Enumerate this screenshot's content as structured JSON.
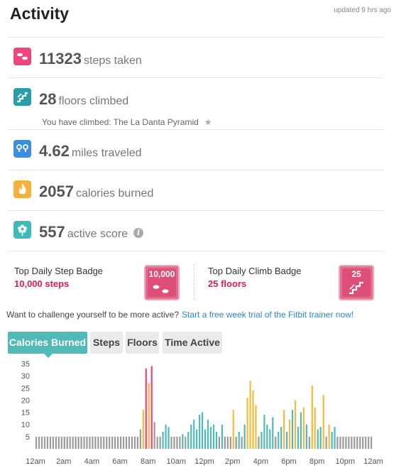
{
  "header": {
    "title": "Activity",
    "updated": "updated 9 hrs ago"
  },
  "stats": [
    {
      "value": "11323",
      "unit": "steps taken",
      "icon": "footsteps-icon",
      "color": "#f0457a"
    },
    {
      "value": "28",
      "unit": "floors climbed",
      "icon": "stairs-icon",
      "color": "#2a9da6",
      "sub": "You have climbed: The La Danta Pyramid"
    },
    {
      "value": "4.62",
      "unit": "miles traveled",
      "icon": "route-icon",
      "color": "#3b8ee0"
    },
    {
      "value": "2057",
      "unit": "calories burned",
      "icon": "flame-icon",
      "color": "#f7b03a"
    },
    {
      "value": "557",
      "unit": "active score",
      "icon": "flower-icon",
      "color": "#3fbbb5"
    }
  ],
  "badges": {
    "step": {
      "label": "Top Daily Step Badge",
      "value": "10,000 steps",
      "badge_text": "10,000"
    },
    "climb": {
      "label": "Top Daily Climb Badge",
      "value": "25 floors",
      "badge_text": "25"
    }
  },
  "promo": {
    "text": "Want to challenge yourself to be more active?",
    "link": "Start a free week trial of the Fitbit trainer now!"
  },
  "tabs": [
    {
      "label": "Calories Burned",
      "active": true
    },
    {
      "label": "Steps",
      "active": false
    },
    {
      "label": "Floors",
      "active": false
    },
    {
      "label": "Time Active",
      "active": false
    }
  ],
  "colors": {
    "sedentary": "#999999",
    "light": "#4fbab6",
    "moderate": "#f7b93a",
    "very": "#f0457a"
  },
  "chart_data": {
    "type": "bar",
    "ylim": [
      0,
      35
    ],
    "yticks": [
      "5",
      "10",
      "15",
      "20",
      "25",
      "30",
      "35"
    ],
    "xticks": [
      "12am",
      "2am",
      "4am",
      "6am",
      "8am",
      "10am",
      "12pm",
      "2pm",
      "4pm",
      "6pm",
      "8pm",
      "10pm",
      "12am"
    ],
    "baseline": 5,
    "bars": [
      {
        "i": 37,
        "v": 8,
        "level": "sedentary"
      },
      {
        "i": 38,
        "v": 16,
        "level": "moderate"
      },
      {
        "i": 39,
        "v": 33,
        "level": "very"
      },
      {
        "i": 40,
        "v": 27,
        "level": "moderate"
      },
      {
        "i": 41,
        "v": 34,
        "level": "very"
      },
      {
        "i": 42,
        "v": 11,
        "level": "sedentary"
      },
      {
        "i": 45,
        "v": 7,
        "level": "light"
      },
      {
        "i": 46,
        "v": 10,
        "level": "light"
      },
      {
        "i": 47,
        "v": 9,
        "level": "light"
      },
      {
        "i": 52,
        "v": 6,
        "level": "light"
      },
      {
        "i": 54,
        "v": 7,
        "level": "light"
      },
      {
        "i": 55,
        "v": 10,
        "level": "light"
      },
      {
        "i": 56,
        "v": 12,
        "level": "light"
      },
      {
        "i": 57,
        "v": 8,
        "level": "light"
      },
      {
        "i": 58,
        "v": 14,
        "level": "light"
      },
      {
        "i": 59,
        "v": 15,
        "level": "light"
      },
      {
        "i": 60,
        "v": 8,
        "level": "light"
      },
      {
        "i": 61,
        "v": 12,
        "level": "light"
      },
      {
        "i": 62,
        "v": 9,
        "level": "light"
      },
      {
        "i": 63,
        "v": 10,
        "level": "light"
      },
      {
        "i": 64,
        "v": 7,
        "level": "light"
      },
      {
        "i": 66,
        "v": 10,
        "level": "light"
      },
      {
        "i": 70,
        "v": 16,
        "level": "moderate"
      },
      {
        "i": 72,
        "v": 7,
        "level": "light"
      },
      {
        "i": 74,
        "v": 10,
        "level": "light"
      },
      {
        "i": 75,
        "v": 21,
        "level": "moderate"
      },
      {
        "i": 76,
        "v": 28,
        "level": "moderate"
      },
      {
        "i": 77,
        "v": 24,
        "level": "moderate"
      },
      {
        "i": 78,
        "v": 18,
        "level": "moderate"
      },
      {
        "i": 80,
        "v": 7,
        "level": "light"
      },
      {
        "i": 81,
        "v": 14,
        "level": "light"
      },
      {
        "i": 82,
        "v": 10,
        "level": "light"
      },
      {
        "i": 83,
        "v": 8,
        "level": "light"
      },
      {
        "i": 84,
        "v": 13,
        "level": "light"
      },
      {
        "i": 86,
        "v": 7,
        "level": "light"
      },
      {
        "i": 87,
        "v": 9,
        "level": "light"
      },
      {
        "i": 88,
        "v": 16,
        "level": "moderate"
      },
      {
        "i": 89,
        "v": 7,
        "level": "light"
      },
      {
        "i": 90,
        "v": 12,
        "level": "moderate"
      },
      {
        "i": 91,
        "v": 16,
        "level": "light"
      },
      {
        "i": 92,
        "v": 20,
        "level": "moderate"
      },
      {
        "i": 93,
        "v": 9,
        "level": "light"
      },
      {
        "i": 94,
        "v": 15,
        "level": "light"
      },
      {
        "i": 95,
        "v": 17,
        "level": "moderate"
      },
      {
        "i": 96,
        "v": 10,
        "level": "light"
      },
      {
        "i": 98,
        "v": 26,
        "level": "moderate"
      },
      {
        "i": 99,
        "v": 17,
        "level": "moderate"
      },
      {
        "i": 100,
        "v": 8,
        "level": "light"
      },
      {
        "i": 101,
        "v": 9,
        "level": "light"
      },
      {
        "i": 102,
        "v": 22,
        "level": "moderate"
      },
      {
        "i": 104,
        "v": 10,
        "level": "moderate"
      },
      {
        "i": 105,
        "v": 7,
        "level": "light"
      },
      {
        "i": 106,
        "v": 9,
        "level": "light"
      }
    ]
  }
}
